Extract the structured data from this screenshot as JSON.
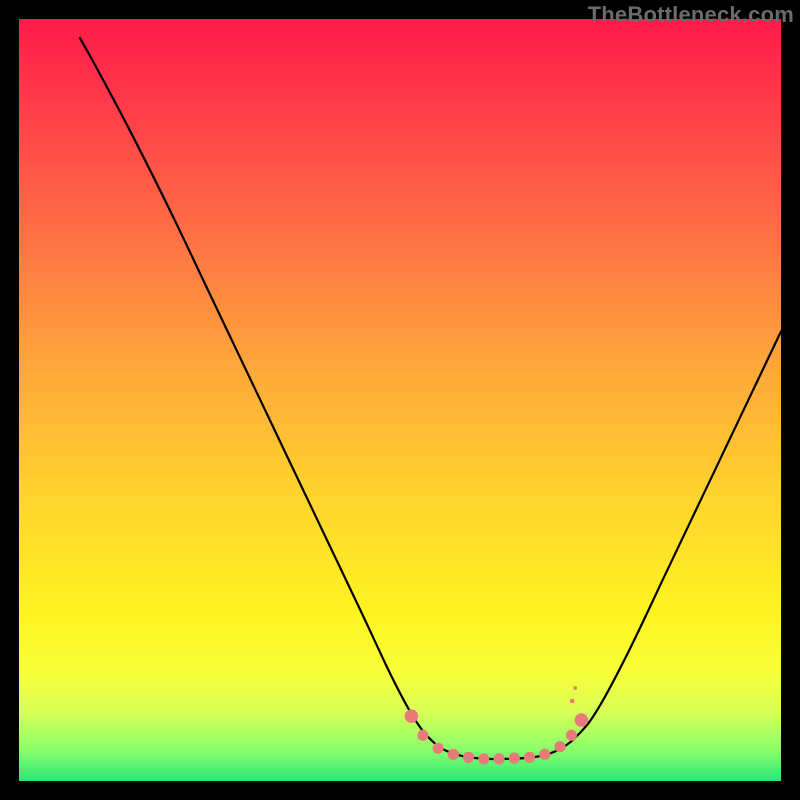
{
  "watermark": "TheBottleneck.com",
  "chart_data": {
    "type": "line",
    "title": "",
    "xlabel": "",
    "ylabel": "",
    "xlim": [
      0,
      100
    ],
    "ylim": [
      0,
      100
    ],
    "grid": false,
    "legend": false,
    "background_gradient": {
      "stops": [
        {
          "offset": 0.0,
          "color": "#ff1a4b"
        },
        {
          "offset": 0.12,
          "color": "#ff3d49"
        },
        {
          "offset": 0.28,
          "color": "#ff6f45"
        },
        {
          "offset": 0.45,
          "color": "#ffa53b"
        },
        {
          "offset": 0.62,
          "color": "#ffd22e"
        },
        {
          "offset": 0.78,
          "color": "#fff421"
        },
        {
          "offset": 0.86,
          "color": "#f7ff3a"
        },
        {
          "offset": 0.91,
          "color": "#d6ff57"
        },
        {
          "offset": 0.96,
          "color": "#88ff6a"
        },
        {
          "offset": 1.0,
          "color": "#28e67a"
        }
      ]
    },
    "series": [
      {
        "name": "bottleneck-curve",
        "points": [
          {
            "x": 8.0,
            "y": 97.5
          },
          {
            "x": 10.5,
            "y": 93.0
          },
          {
            "x": 15.0,
            "y": 84.5
          },
          {
            "x": 20.0,
            "y": 74.5
          },
          {
            "x": 25.0,
            "y": 64.0
          },
          {
            "x": 30.0,
            "y": 53.5
          },
          {
            "x": 35.0,
            "y": 43.0
          },
          {
            "x": 40.0,
            "y": 32.5
          },
          {
            "x": 45.0,
            "y": 22.0
          },
          {
            "x": 49.0,
            "y": 13.5
          },
          {
            "x": 52.0,
            "y": 8.0
          },
          {
            "x": 54.5,
            "y": 5.0
          },
          {
            "x": 57.0,
            "y": 3.6
          },
          {
            "x": 60.0,
            "y": 3.0
          },
          {
            "x": 64.0,
            "y": 2.9
          },
          {
            "x": 68.0,
            "y": 3.2
          },
          {
            "x": 71.0,
            "y": 4.2
          },
          {
            "x": 73.5,
            "y": 6.2
          },
          {
            "x": 76.0,
            "y": 9.5
          },
          {
            "x": 80.0,
            "y": 17.0
          },
          {
            "x": 85.0,
            "y": 27.5
          },
          {
            "x": 90.0,
            "y": 38.0
          },
          {
            "x": 95.0,
            "y": 48.5
          },
          {
            "x": 100.0,
            "y": 59.0
          }
        ]
      },
      {
        "name": "floor-markers",
        "points": [
          {
            "x": 51.5,
            "y": 8.5
          },
          {
            "x": 53.0,
            "y": 6.0
          },
          {
            "x": 55.0,
            "y": 4.3
          },
          {
            "x": 57.0,
            "y": 3.5
          },
          {
            "x": 59.0,
            "y": 3.1
          },
          {
            "x": 61.0,
            "y": 2.9
          },
          {
            "x": 63.0,
            "y": 2.9
          },
          {
            "x": 65.0,
            "y": 3.0
          },
          {
            "x": 67.0,
            "y": 3.1
          },
          {
            "x": 69.0,
            "y": 3.5
          },
          {
            "x": 71.0,
            "y": 4.5
          },
          {
            "x": 72.5,
            "y": 6.0
          },
          {
            "x": 73.8,
            "y": 8.0
          }
        ]
      }
    ]
  }
}
